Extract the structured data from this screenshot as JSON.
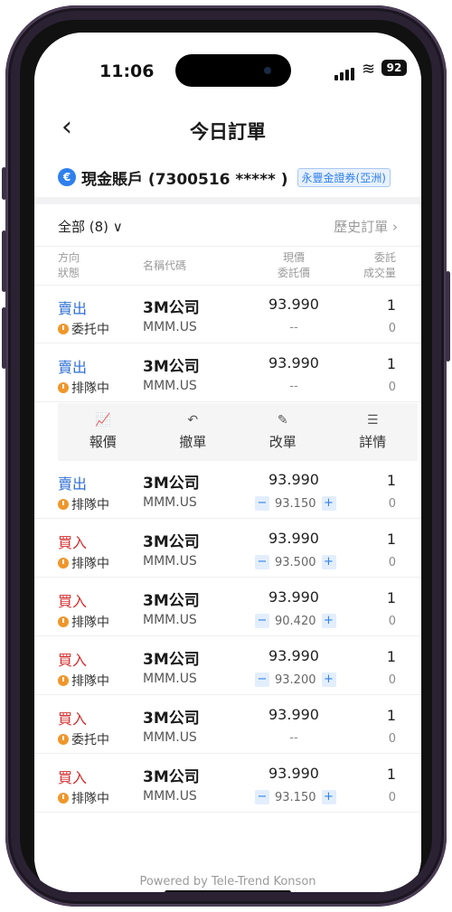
{
  "status": {
    "time": "11:06",
    "battery": "92"
  },
  "header": {
    "title": "今日訂單",
    "back_glyph": "‹"
  },
  "account": {
    "icon_glyph": "€",
    "name": "現金賬戶 (7300516 ***** )",
    "broker": "永豐金證券(亞洲)"
  },
  "filter": {
    "label": "全部 (8) ∨",
    "history": "歷史訂單 ›"
  },
  "columns": {
    "direction": "方向",
    "status": "狀態",
    "name_code": "名稱代碼",
    "current_price": "現價",
    "order_price": "委託價",
    "quantity": "委託",
    "filled": "成交量"
  },
  "actions": [
    {
      "label": "報價",
      "icon": "chart-icon",
      "glyph": "📈"
    },
    {
      "label": "撤單",
      "icon": "undo-icon",
      "glyph": "↶"
    },
    {
      "label": "改單",
      "icon": "edit-icon",
      "glyph": "✎"
    },
    {
      "label": "詳情",
      "icon": "details-icon",
      "glyph": "☰"
    }
  ],
  "orders": [
    {
      "direction": "賣出",
      "side": "sell",
      "status": "委托中",
      "name": "3M公司",
      "code": "MMM.US",
      "price": "93.990",
      "order_price": "--",
      "editable": false,
      "qty": "1",
      "filled": "0"
    },
    {
      "direction": "賣出",
      "side": "sell",
      "status": "排隊中",
      "name": "3M公司",
      "code": "MMM.US",
      "price": "93.990",
      "order_price": "--",
      "editable": false,
      "qty": "1",
      "filled": "0"
    },
    {
      "direction": "賣出",
      "side": "sell",
      "status": "排隊中",
      "name": "3M公司",
      "code": "MMM.US",
      "price": "93.990",
      "order_price": "93.150",
      "editable": true,
      "qty": "1",
      "filled": "0"
    },
    {
      "direction": "買入",
      "side": "buy",
      "status": "排隊中",
      "name": "3M公司",
      "code": "MMM.US",
      "price": "93.990",
      "order_price": "93.500",
      "editable": true,
      "qty": "1",
      "filled": "0"
    },
    {
      "direction": "買入",
      "side": "buy",
      "status": "排隊中",
      "name": "3M公司",
      "code": "MMM.US",
      "price": "93.990",
      "order_price": "90.420",
      "editable": true,
      "qty": "1",
      "filled": "0"
    },
    {
      "direction": "買入",
      "side": "buy",
      "status": "排隊中",
      "name": "3M公司",
      "code": "MMM.US",
      "price": "93.990",
      "order_price": "93.200",
      "editable": true,
      "qty": "1",
      "filled": "0"
    },
    {
      "direction": "買入",
      "side": "buy",
      "status": "委托中",
      "name": "3M公司",
      "code": "MMM.US",
      "price": "93.990",
      "order_price": "--",
      "editable": false,
      "qty": "1",
      "filled": "0"
    },
    {
      "direction": "買入",
      "side": "buy",
      "status": "排隊中",
      "name": "3M公司",
      "code": "MMM.US",
      "price": "93.990",
      "order_price": "93.150",
      "editable": true,
      "qty": "1",
      "filled": "0"
    }
  ],
  "stepper": {
    "minus": "−",
    "plus": "+"
  },
  "footer": "Powered by Tele-Trend Konson"
}
